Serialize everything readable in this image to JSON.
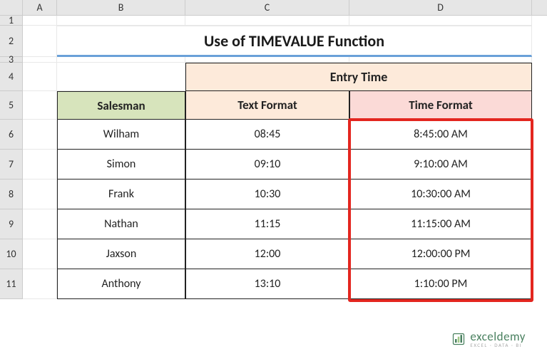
{
  "columns": [
    "A",
    "B",
    "C",
    "D"
  ],
  "rows": [
    "1",
    "2",
    "3",
    "4",
    "5",
    "6",
    "7",
    "8",
    "9",
    "10",
    "11"
  ],
  "title": "Use of TIMEVALUE Function",
  "headers": {
    "entry": "Entry Time",
    "salesman": "Salesman",
    "text_format": "Text Format",
    "time_format": "Time Format"
  },
  "chart_data": {
    "type": "table",
    "title": "Use of TIMEVALUE Function",
    "columns": [
      "Salesman",
      "Text Format",
      "Time Format"
    ],
    "rows": [
      {
        "salesman": "Wilham",
        "text": "08:45",
        "time": "8:45:00 AM"
      },
      {
        "salesman": "Simon",
        "text": "09:10",
        "time": "9:10:00 AM"
      },
      {
        "salesman": "Frank",
        "text": "10:30",
        "time": "10:30:00 AM"
      },
      {
        "salesman": "Nathan",
        "text": "11:15",
        "time": "11:15:00 AM"
      },
      {
        "salesman": "Jaxson",
        "text": "12:00",
        "time": "12:00:00 PM"
      },
      {
        "salesman": "Anthony",
        "text": "13:10",
        "time": "1:10:00 PM"
      }
    ]
  },
  "watermark": {
    "main": "exceldemy",
    "sub": "EXCEL · DATA · BI"
  }
}
